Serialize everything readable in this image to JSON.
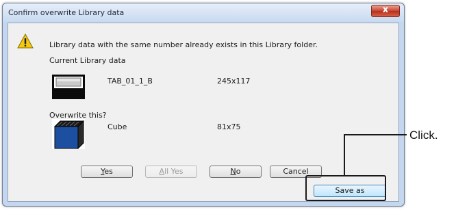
{
  "dialog": {
    "title": "Confirm overwrite Library data",
    "close_label": "x",
    "message": "Library data with the same number already exists in this Library folder.",
    "current_heading": "Current Library data",
    "current_item": {
      "name": "TAB_01_1_B",
      "size": "245x117"
    },
    "overwrite_heading": "Overwrite this?",
    "new_item": {
      "name": "Cube",
      "size": "81x75"
    },
    "buttons": {
      "yes_key": "Y",
      "yes_rest": "es",
      "all_yes_key": "A",
      "all_yes_rest": "ll Yes",
      "no_key": "N",
      "no_rest": "o",
      "cancel": "Cancel",
      "save_as": "Save as"
    }
  },
  "annotation": {
    "label": "Click."
  },
  "colors": {
    "callout": "#1a1a1a",
    "warning": "#f2c811",
    "cube": "#1d4fa1"
  },
  "icons": [
    "warning-icon",
    "close-icon"
  ]
}
